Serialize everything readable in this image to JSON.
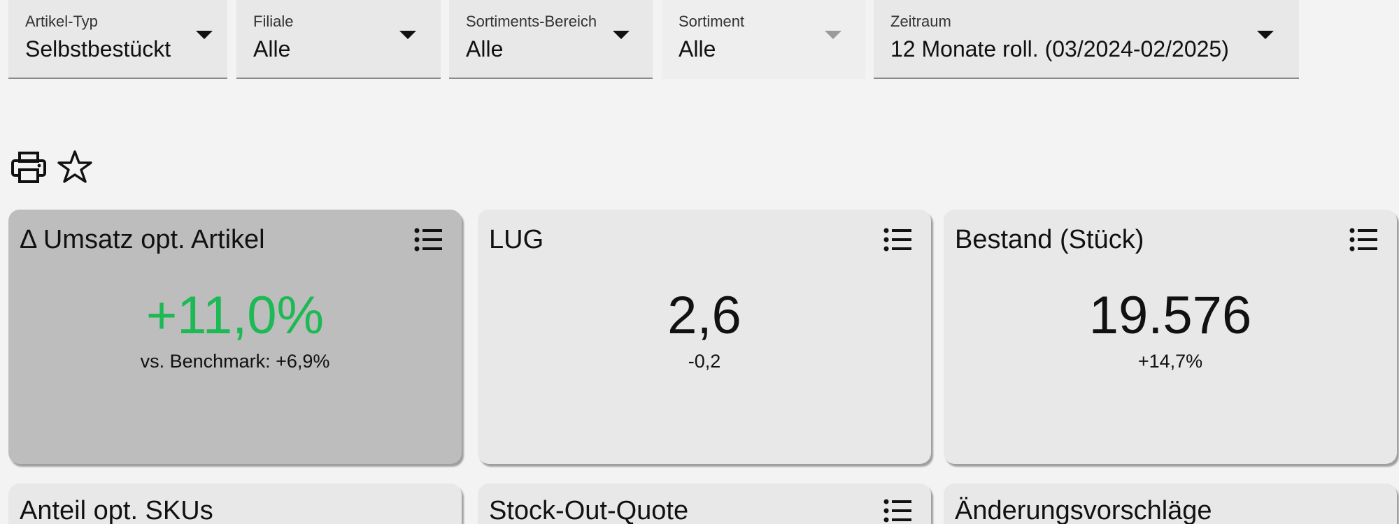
{
  "filters": [
    {
      "label": "Artikel-Typ",
      "value": "Selbstbestückt"
    },
    {
      "label": "Filiale",
      "value": "Alle"
    },
    {
      "label": "Sortiments-Bereich",
      "value": "Alle"
    },
    {
      "label": "Sortiment",
      "value": "Alle"
    },
    {
      "label": "Zeitraum",
      "value": "12 Monate roll. (03/2024-02/2025)"
    }
  ],
  "toolbar": {
    "icons": [
      "printer-icon",
      "star-icon"
    ]
  },
  "cards": [
    {
      "title": "Δ Umsatz opt. Artikel",
      "value": "+11,0%",
      "sub": "vs. Benchmark: +6,9%"
    },
    {
      "title": "LUG",
      "value": "2,6",
      "sub": "-0,2"
    },
    {
      "title": "Bestand (Stück)",
      "value": "19.576",
      "sub": "+14,7%"
    },
    {
      "title": "Anteil opt. SKUs"
    },
    {
      "title": "Stock-Out-Quote"
    },
    {
      "title": "Änderungsvorschläge"
    }
  ],
  "colors": {
    "background": "#f3f3f3",
    "card": "#e8e8e8",
    "card_active": "#bdbdbd",
    "positive": "#1db954",
    "caret_disabled": "#9a9a9a"
  }
}
